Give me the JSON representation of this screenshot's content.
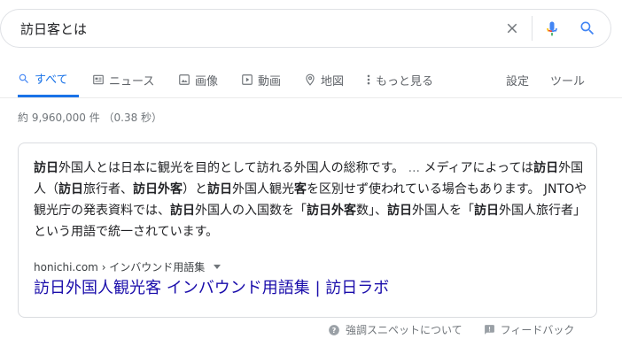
{
  "search": {
    "query": "訪日客とは"
  },
  "tabs": [
    {
      "label": "すべて",
      "icon": "search-icon",
      "active": true
    },
    {
      "label": "ニュース",
      "icon": "news-icon"
    },
    {
      "label": "画像",
      "icon": "image-icon"
    },
    {
      "label": "動画",
      "icon": "video-icon"
    },
    {
      "label": "地図",
      "icon": "map-pin-icon"
    },
    {
      "label": "もっと見る",
      "icon": "more-vert-icon"
    }
  ],
  "tools": {
    "settings_label": "設定",
    "tools_label": "ツール"
  },
  "result_stats": "約 9,960,000 件 （0.38 秒）",
  "featured_snippet": {
    "text_segments": [
      {
        "t": "訪日",
        "b": true
      },
      {
        "t": "外国人とは日本に観光を目的として訪れる外国人の総称です。 ",
        "b": false
      },
      {
        "t": "... ",
        "b": false,
        "ell": true
      },
      {
        "t": "メディアによっては",
        "b": false
      },
      {
        "t": "訪日",
        "b": true
      },
      {
        "t": "外国人（",
        "b": false
      },
      {
        "t": "訪日",
        "b": true
      },
      {
        "t": "旅行者、",
        "b": false
      },
      {
        "t": "訪日外客",
        "b": true
      },
      {
        "t": "）と",
        "b": false
      },
      {
        "t": "訪日",
        "b": true
      },
      {
        "t": "外国人観光",
        "b": false
      },
      {
        "t": "客",
        "b": true
      },
      {
        "t": "を区別せず",
        "b": false
      },
      {
        "t": "使われている場合もあります。 JNTOや観光庁の発表資料では、",
        "b": false
      },
      {
        "t": "訪日",
        "b": true
      },
      {
        "t": "外国人の入国数を「",
        "b": false
      },
      {
        "t": "訪日外客",
        "b": true
      },
      {
        "t": "数」、",
        "b": false
      },
      {
        "t": "訪日",
        "b": true
      },
      {
        "t": "外国人を「",
        "b": false
      },
      {
        "t": "訪日",
        "b": true
      },
      {
        "t": "外国人旅行者」という用語で統一されています。",
        "b": false
      }
    ],
    "cite_domain": "honichi.com",
    "cite_path": " › インバウンド用語集",
    "title": "訪日外国人観光客 インバウンド用語集 | 訪日ラボ"
  },
  "feedback": {
    "about_label": "強調スニペットについて",
    "feedback_label": "フィードバック"
  },
  "colors": {
    "link": "#1a0dab",
    "accent": "#1a73e8",
    "mic_blue": "#4285f4",
    "mic_red": "#ea4335",
    "mic_yellow": "#fbbc05",
    "mic_green": "#34a853"
  }
}
